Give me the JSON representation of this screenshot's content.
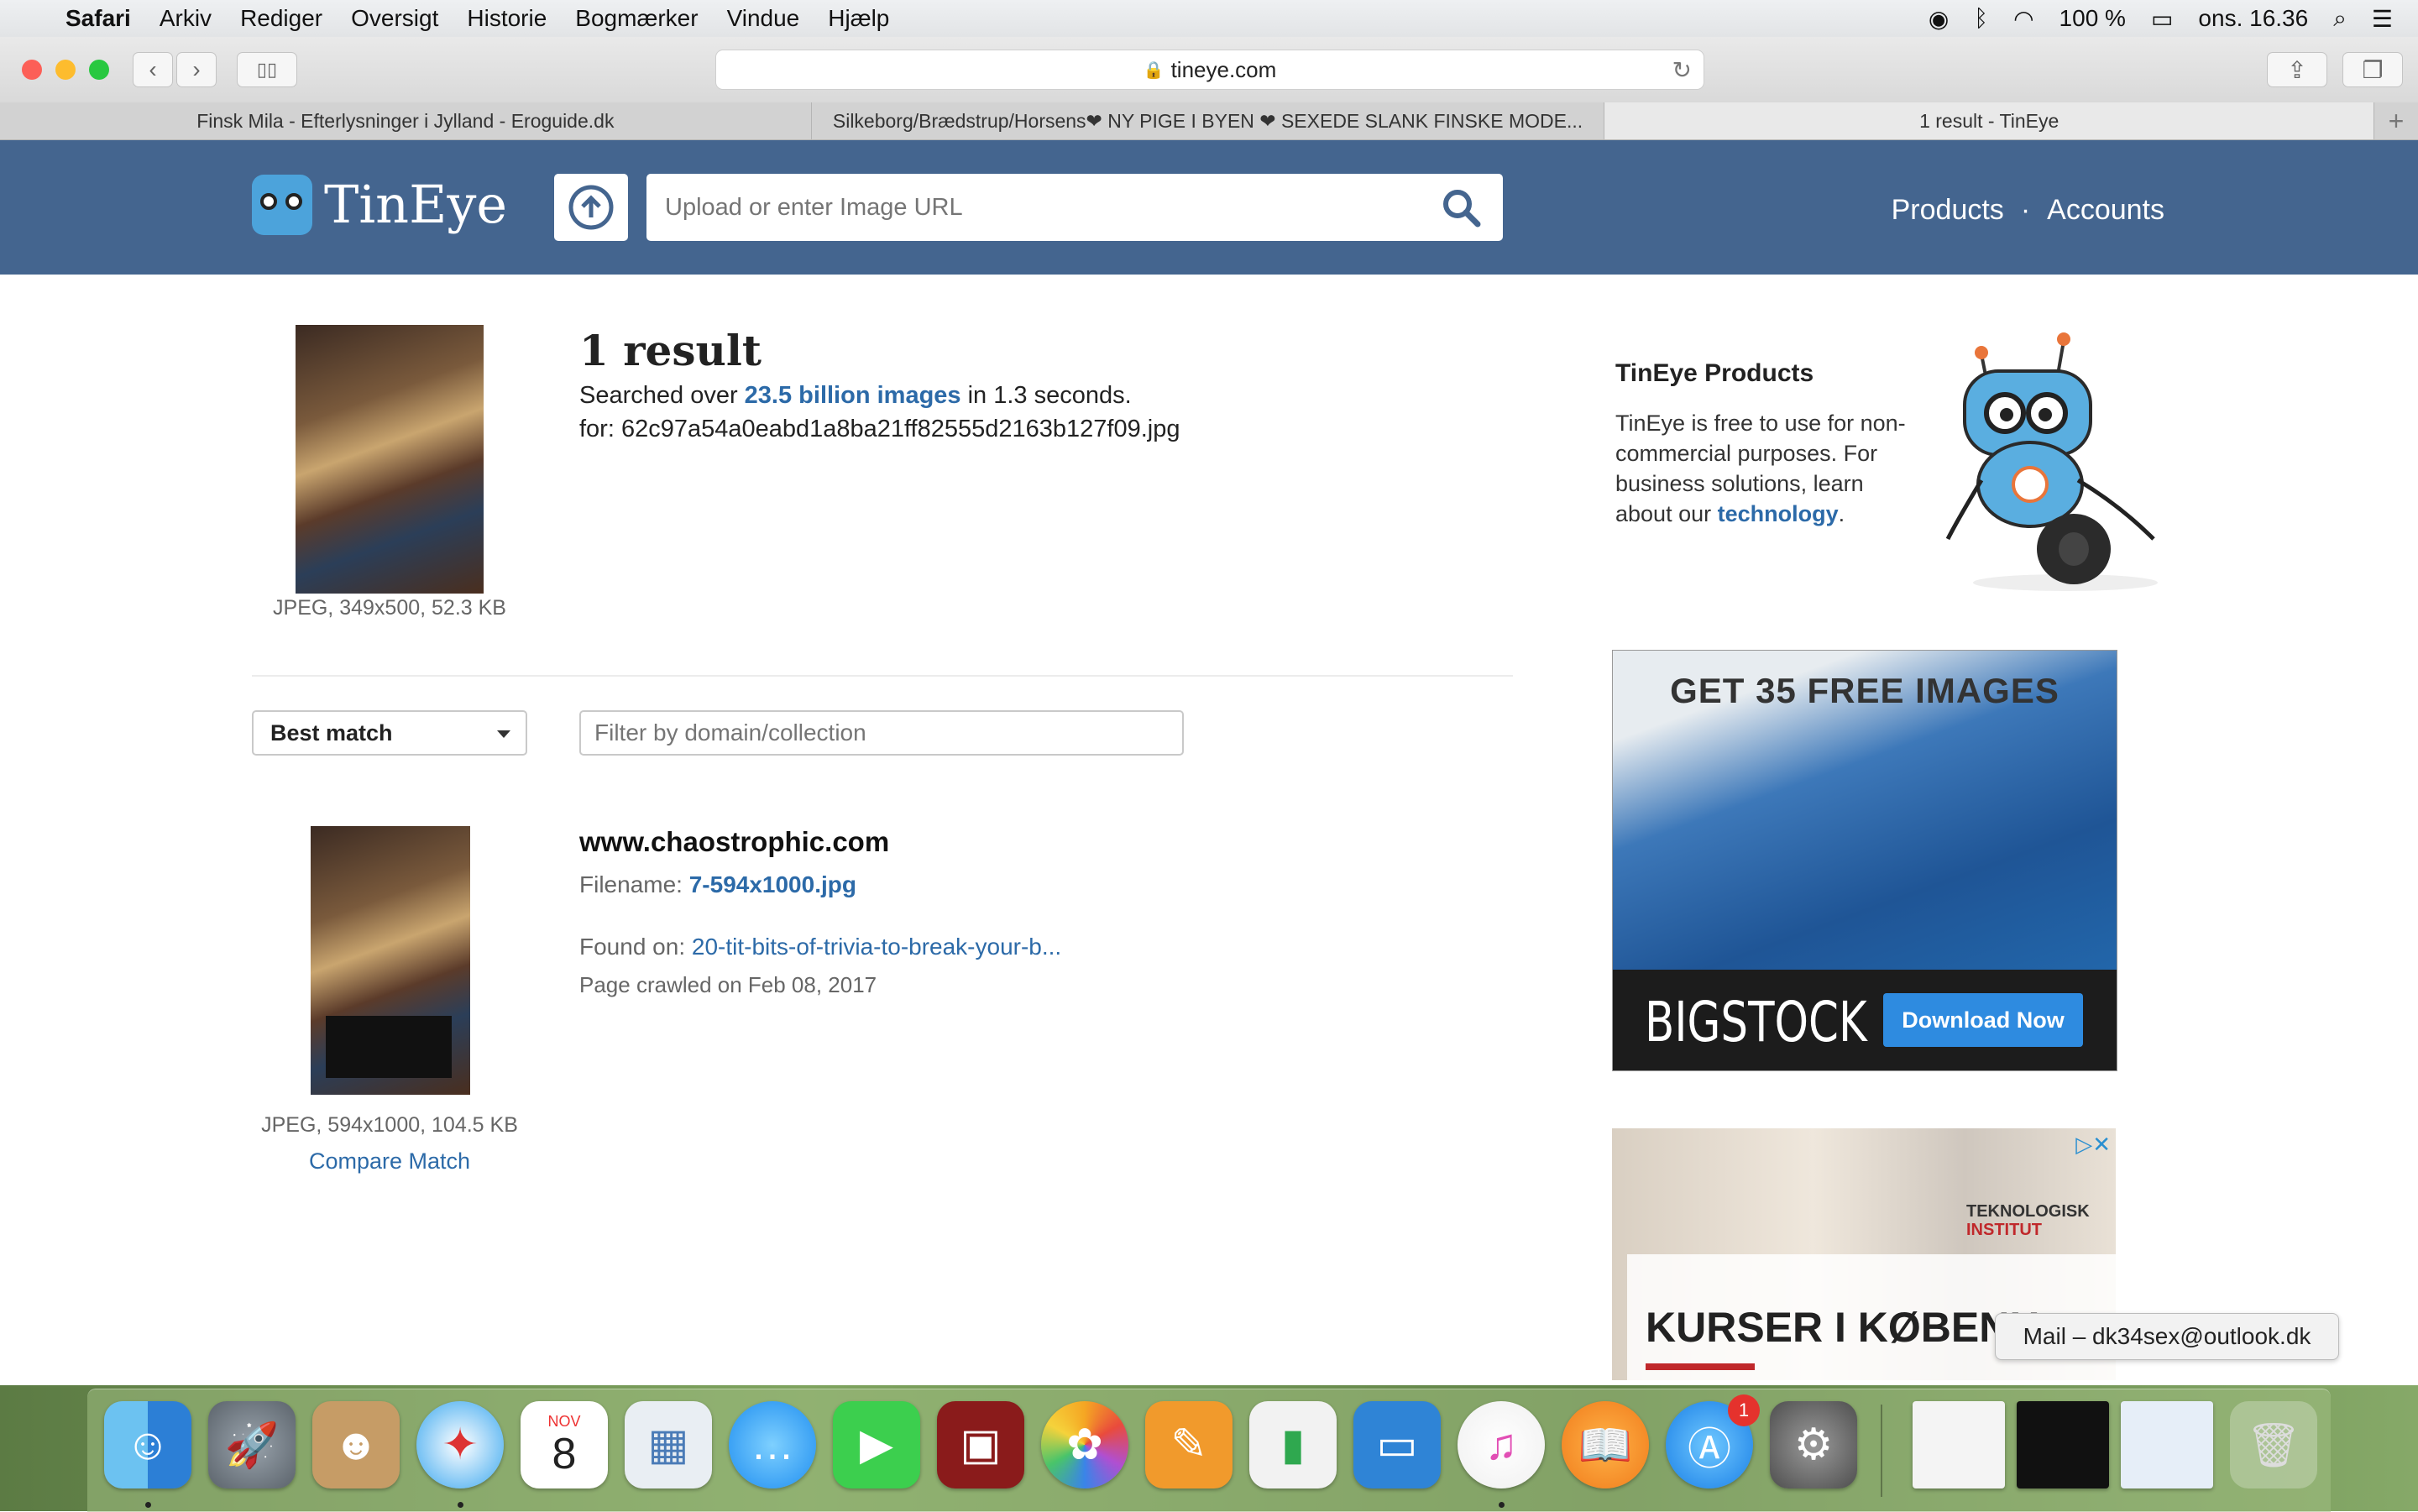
{
  "menubar": {
    "app_name": "Safari",
    "items": [
      "Arkiv",
      "Rediger",
      "Oversigt",
      "Historie",
      "Bogmærker",
      "Vindue",
      "Hjælp"
    ],
    "battery": "100 %",
    "clock": "ons. 16.36"
  },
  "browser": {
    "url": "tineye.com",
    "tabs": [
      {
        "title": "Finsk Mila - Efterlysninger i Jylland - Eroguide.dk"
      },
      {
        "title": "Silkeborg/Brædstrup/Horsens❤ NY PIGE I BYEN ❤ SEXEDE SLANK FINSKE MODE..."
      },
      {
        "title": "1 result - TinEye"
      }
    ],
    "new_tab": "+"
  },
  "site": {
    "brand": "TinEye",
    "search_placeholder": "Upload or enter Image URL",
    "nav_products": "Products",
    "nav_separator": "·",
    "nav_accounts": "Accounts"
  },
  "query": {
    "meta": "JPEG, 349x500, 52.3 KB",
    "result_count": "1 result",
    "searched_prefix": "Searched over ",
    "searched_link": "23.5 billion images",
    "searched_suffix": " in 1.3 seconds.",
    "for_line": "for: 62c97a54a0eabd1a8ba21ff82555d2163b127f09.jpg"
  },
  "controls": {
    "sort_value": "Best match",
    "filter_placeholder": "Filter by domain/collection"
  },
  "match": {
    "domain": "www.chaostrophic.com",
    "filename_label": "Filename: ",
    "filename": "7-594x1000.jpg",
    "found_label": "Found on: ",
    "found_link": "20-tit-bits-of-trivia-to-break-your-b...",
    "crawled": "Page crawled on Feb 08, 2017",
    "meta": "JPEG, 594x1000, 104.5 KB",
    "compare": "Compare Match"
  },
  "sidebar": {
    "title": "TinEye Products",
    "text_prefix": "TinEye is free to use for non-commercial purposes. For business solutions, learn about our ",
    "text_link": "technology",
    "text_suffix": "."
  },
  "ads": {
    "ad1_headline": "GET 35 FREE IMAGES",
    "ad1_brand": "BIGSTOCK",
    "ad1_button": "Download Now",
    "ad2_logo_line1": "TEKNOLOGISK",
    "ad2_logo_line2": "INSTITUT",
    "ad2_headline": "KURSER I KØBENH"
  },
  "tooltip": "Mail – dk34sex@outlook.dk",
  "dock": {
    "calendar_month": "NOV",
    "calendar_day": "8",
    "appstore_badge": "1",
    "icons": [
      "finder-icon",
      "launchpad-icon",
      "contacts-icon",
      "safari-icon",
      "calendar-icon",
      "preview-icon",
      "messages-icon",
      "facetime-icon",
      "photobooth-icon",
      "photos-icon",
      "pages-icon",
      "numbers-icon",
      "keynote-icon",
      "itunes-icon",
      "ibooks-icon",
      "appstore-icon",
      "system-preferences-icon"
    ]
  },
  "colors": {
    "header_blue": "#44658f",
    "link_blue": "#2c6aa8",
    "ad_button_blue": "#2e8be0"
  }
}
